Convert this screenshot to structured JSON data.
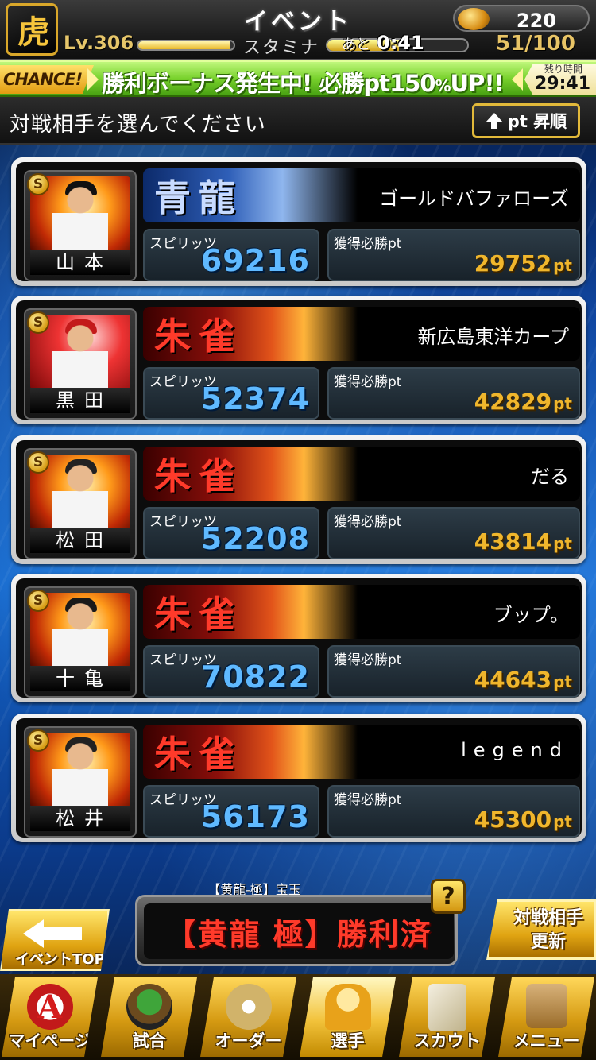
{
  "header": {
    "team_logo": "虎",
    "title": "イベント",
    "coin_icon": "coin-icon",
    "coin_count": "220",
    "level": "Lv.306",
    "stamina_label": "スタミナ",
    "stamina_timer_prefix": "あと",
    "stamina_timer": "0:41",
    "stamina_value": "51/100",
    "stamina_fraction": 0.51
  },
  "banner": {
    "chance_label": "CHANCE!",
    "text_main": "勝利ボーナス発生中! 必勝pt150",
    "text_percent": "%",
    "text_tail": "UP!!",
    "remaining_label": "残り時間",
    "remaining_time": "29:41"
  },
  "instruction": {
    "text": "対戦相手を選んでください",
    "sort_label": "pt 昇順",
    "sort_icon": "arrow-up-icon"
  },
  "opponents": [
    {
      "player_name": "山本",
      "rarity": "S",
      "crest": "青龍",
      "crest_color": "#2f5fb8",
      "team": "ゴールドバファローズ",
      "spirits_label": "スピリッツ",
      "spirits": "69216",
      "points_label": "獲得必勝pt",
      "points": "29752",
      "unit": "pt"
    },
    {
      "player_name": "黒田",
      "rarity": "S",
      "crest": "朱雀",
      "crest_color": "#c0200f",
      "team": "新広島東洋カープ",
      "spirits_label": "スピリッツ",
      "spirits": "52374",
      "points_label": "獲得必勝pt",
      "points": "42829",
      "unit": "pt"
    },
    {
      "player_name": "松田",
      "rarity": "S",
      "crest": "朱雀",
      "crest_color": "#c0200f",
      "team": "だる",
      "spirits_label": "スピリッツ",
      "spirits": "52208",
      "points_label": "獲得必勝pt",
      "points": "43814",
      "unit": "pt"
    },
    {
      "player_name": "十亀",
      "rarity": "S",
      "crest": "朱雀",
      "crest_color": "#c0200f",
      "team": "ブップ。",
      "spirits_label": "スピリッツ",
      "spirits": "70822",
      "points_label": "獲得必勝pt",
      "points": "44643",
      "unit": "pt"
    },
    {
      "player_name": "松井",
      "rarity": "S",
      "crest": "朱雀",
      "crest_color": "#c0200f",
      "team": "legend",
      "spirits_label": "スピリッツ",
      "spirits": "56173",
      "points_label": "獲得必勝pt",
      "points": "45300",
      "unit": "pt"
    }
  ],
  "bottom": {
    "event_top_label": "イベントTOP",
    "item_caption": "【黄龍-極】宝玉",
    "item_name": "【黄龍 極】勝利済",
    "help_label": "?",
    "refresh_line1": "対戦相手",
    "refresh_line2": "更新"
  },
  "tabs": [
    {
      "label": "マイページ",
      "icon": "mypage-icon",
      "glyph": "A"
    },
    {
      "label": "試合",
      "icon": "stadium-icon",
      "glyph": ""
    },
    {
      "label": "オーダー",
      "icon": "order-icon",
      "glyph": ""
    },
    {
      "label": "選手",
      "icon": "player-icon",
      "glyph": ""
    },
    {
      "label": "スカウト",
      "icon": "scout-icon",
      "glyph": ""
    },
    {
      "label": "メニュー",
      "icon": "menu-icon",
      "glyph": ""
    }
  ]
}
